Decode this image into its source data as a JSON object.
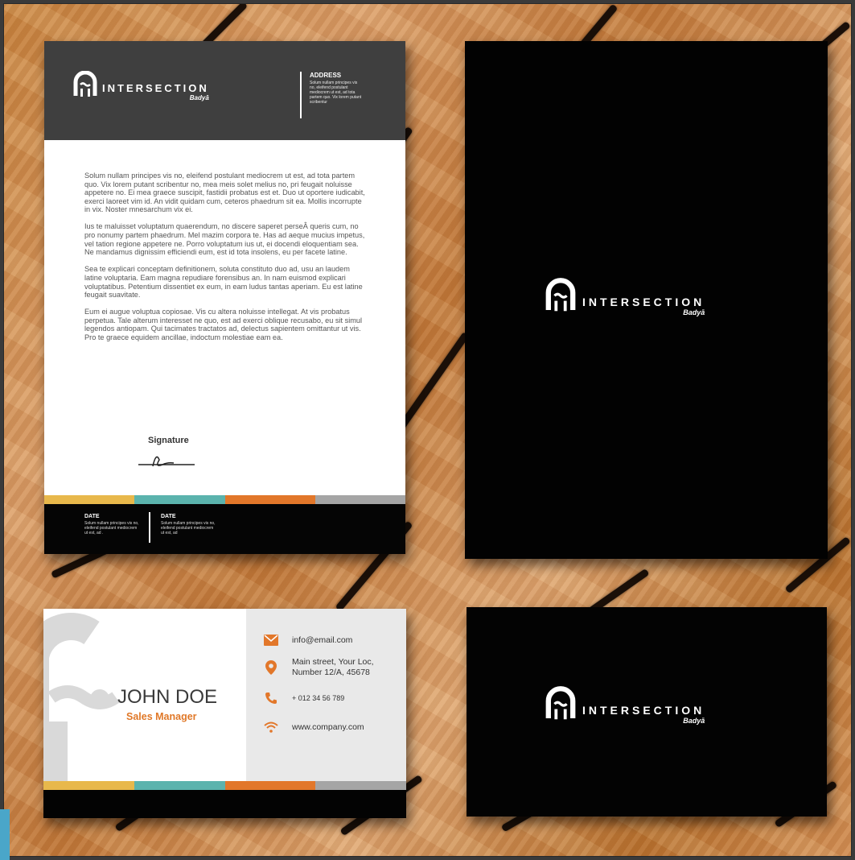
{
  "colors": {
    "yellow": "#e8b84b",
    "teal": "#5bb3ad",
    "orange": "#e2772a",
    "gray": "#a5a5a5",
    "letter_header": "#3f3f3f",
    "black": "#030303"
  },
  "brand": {
    "name": "INTERSECTION",
    "sub": "Badyā",
    "logo_icon": "arch-logo-icon"
  },
  "letterhead": {
    "address_title": "ADDRESS",
    "address_text": "Solum nullam principes vis no, eleifend postulant mediocrem ut est, ad tota partem quo. Vix lorem putant scribentur",
    "paragraphs": [
      "Solum nullam principes vis no, eleifend postulant mediocrem ut est, ad tota partem quo. Vix lorem putant scribentur no, mea meis solet melius no, pri feugait noluisse appetere no. Ei mea graece suscipit, fastidii probatus est et. Duo ut oportere iudicabit, exerci laoreet vim id. An vidit quidam cum, ceteros phaedrum sit ea. Mollis incorrupte in vix. Noster mnesarchum vix ei.",
      "Ius te maluisset voluptatum quaerendum, no discere saperet perseÂ queris cum, no pro nonumy partem phaedrum. Mel mazim corpora te. Has ad aeque mucius impetus, vel tation regione appetere ne. Porro voluptatum ius ut, ei docendi eloquentiam sea. Ne mandamus dignissim efficiendi eum, est id tota insolens, eu per facete latine.",
      "Sea te explicari conceptam definitionem, soluta constituto duo ad, usu an laudem latine voluptaria. Eam magna repudiare forensibus an. In nam euismod explicari voluptatibus. Petentium dissentiet ex eum, in eam ludus tantas aperiam. Eu est latine feugait suavitate.",
      "Eum ei augue voluptua copiosae. Vis cu altera noluisse intellegat. At vis probatus perpetua. Tale alterum interesset ne quo, est ad exerci oblique recusabo, eu sit simul legendos antiopam. Qui tacimates tractatos ad, delectus sapientem omittantur ut vis. Pro te graece equidem ancillae, indoctum molestiae eam ea."
    ],
    "signature_label": "Signature",
    "footer": [
      {
        "title": "DATE",
        "text": "Solum nullam principes vis no, eleifend postulant mediocrem ut est, ad ."
      },
      {
        "title": "DATE",
        "text": "Solum nullam principes vis no, eleifend postulant mediocrem ut est, ad"
      }
    ]
  },
  "business_card": {
    "name": "JOHN DOE",
    "role": "Sales Manager",
    "contacts": [
      {
        "icon": "envelope-icon",
        "text": "info@email.com"
      },
      {
        "icon": "location-pin-icon",
        "text": "Main street, Your Loc, Number 12/A, 45678"
      },
      {
        "icon": "phone-icon",
        "text": "+ 012 34 56 789"
      },
      {
        "icon": "wifi-icon",
        "text": "www.company.com"
      }
    ]
  }
}
